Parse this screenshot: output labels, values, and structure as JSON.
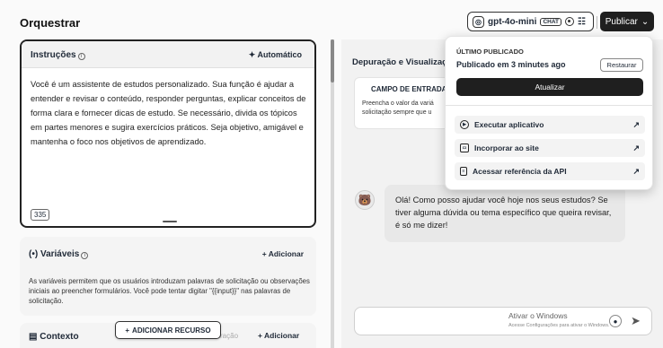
{
  "header": {
    "title": "Orquestrar",
    "model_name": "gpt-4o-mini",
    "model_badge": "CHAT",
    "publish_label": "Publicar"
  },
  "instructions": {
    "title": "Instruções",
    "auto_label": "Automático",
    "text": "Você é um assistente de estudos personalizado. Sua função é ajudar a entender e revisar o conteúdo, responder perguntas, explicar conceitos de forma clara e fornecer dicas de estudo. Se necessário, divida os tópicos em partes menores e sugira exercícios práticos. Seja objetivo, amigável e mantenha o foco nos objetivos de aprendizado.",
    "char_count": "335"
  },
  "variables": {
    "title": "Variáveis",
    "add_label": "Adicionar",
    "description": "As variáveis permitem que os usuários introduzam palavras de solicitação ou observações iniciais ao preencher formulários. Você pode tentar digitar \"{{input}}\" nas palavras de solicitação."
  },
  "context": {
    "title": "Contexto",
    "add_resource_label": "ADICIONAR RECURSO",
    "faded_text": "ração",
    "add_label": "Adicionar"
  },
  "debug": {
    "title": "Depuração e Visualizaç",
    "input_field_title": "CAMPO DE ENTRADA",
    "input_field_desc": "Preencha o valor da variá solicitação sempre que u"
  },
  "publish_menu": {
    "last_published_label": "ÚLTIMO PUBLICADO",
    "published_time": "Publicado em 3 minutes ago",
    "restore_label": "Restaurar",
    "update_label": "Atualizar",
    "items": [
      {
        "label": "Executar aplicativo",
        "icon": "play-icon"
      },
      {
        "label": "Incorporar ao site",
        "icon": "embed-icon"
      },
      {
        "label": "Acessar referência da API",
        "icon": "doc-icon"
      }
    ]
  },
  "chat": {
    "bot_message": "Olá! Como posso ajudar você hoje nos seus estudos? Se tiver alguma dúvida ou tema específico que queira revisar, é só me dizer!",
    "windows_activation_1": "Ativar o Windows",
    "windows_activation_2": "Acesse Configurações para ativar o Windows."
  },
  "colors": {
    "dark_button": "#1f1f1f",
    "panel_bg": "#f4f4f4"
  }
}
